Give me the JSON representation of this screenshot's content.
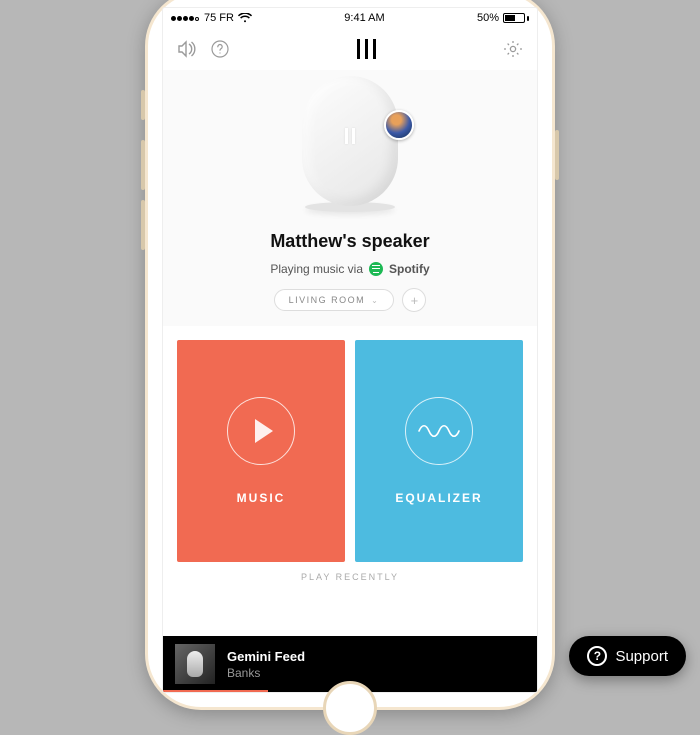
{
  "statusbar": {
    "carrier": "75 FR",
    "time": "9:41 AM",
    "battery_pct": "50%"
  },
  "hero": {
    "device_name": "Matthew's speaker",
    "playing_prefix": "Playing music via",
    "service_name": "Spotify",
    "room_label": "LIVING ROOM"
  },
  "cards": {
    "music_label": "MUSIC",
    "equalizer_label": "EQUALIZER"
  },
  "section_hint": "PLAY RECENTLY",
  "nowplaying": {
    "track": "Gemini Feed",
    "artist": "Banks"
  },
  "support": {
    "label": "Support"
  },
  "colors": {
    "music_card": "#F16A52",
    "eq_card": "#4DBBE0",
    "spotify": "#1DB954"
  }
}
